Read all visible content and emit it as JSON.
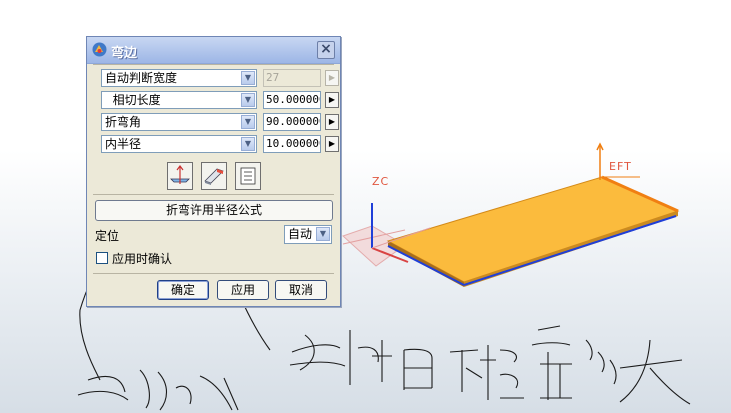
{
  "dialog": {
    "title": "弯边",
    "close_symbol": "×",
    "rows": [
      {
        "label": "自动判断宽度",
        "value": "27",
        "disabled": true
      },
      {
        "label": "  相切长度",
        "value": "50.000000",
        "disabled": false
      },
      {
        "label": "折弯角",
        "value": "90.000000",
        "disabled": false
      },
      {
        "label": "内半径",
        "value": "10.000000",
        "disabled": false
      }
    ],
    "formula_button": "折弯许用半径公式",
    "position_label": "定位",
    "position_select": "自动",
    "confirm_checkbox_label": "应用时确认",
    "ok_button": "确定",
    "apply_button": "应用",
    "cancel_button": "取消"
  },
  "viewport": {
    "zc_label": "ZC",
    "eft_label": "EFT",
    "colors": {
      "plate": "#fbbb3d",
      "plate_edge": "#f07f12",
      "axis_blue": "#1f3fd8"
    }
  }
}
